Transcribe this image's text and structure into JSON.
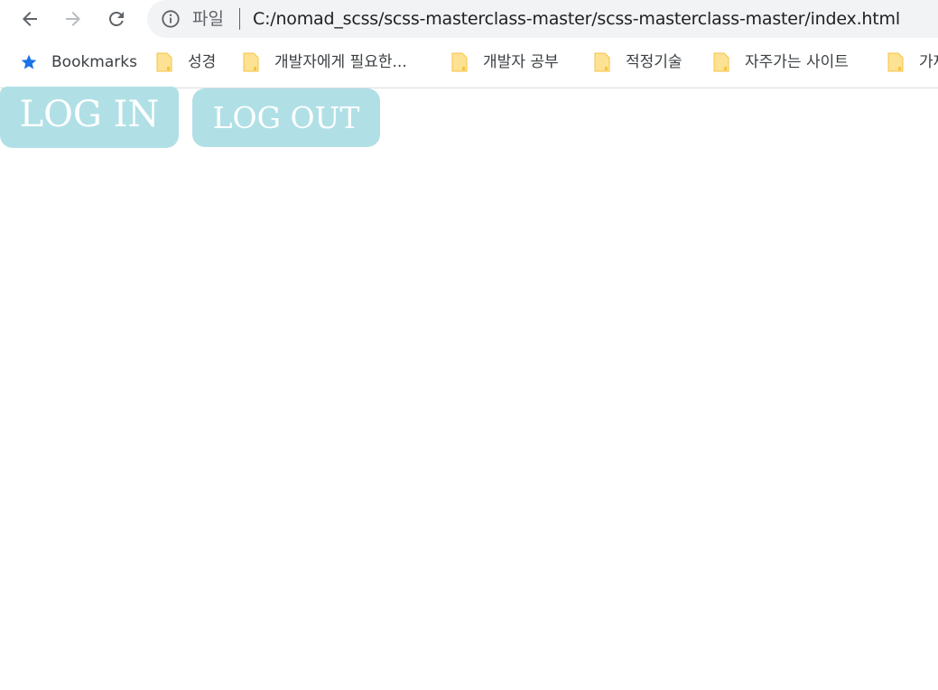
{
  "browser": {
    "omnibox": {
      "scheme_label": "파일",
      "url": "C:/nomad_scss/scss-masterclass-master/scss-masterclass-master/index.html"
    },
    "nav": {
      "back_icon": "arrow-left-icon",
      "forward_icon": "arrow-right-icon",
      "reload_icon": "reload-icon",
      "info_icon": "info-icon"
    },
    "bookmarks": {
      "star_label": "Bookmarks",
      "items": [
        {
          "label": "성경",
          "icon": "folder-icon"
        },
        {
          "label": "개발자에게 필요한...",
          "icon": "folder-icon"
        },
        {
          "label": "개발자 공부",
          "icon": "folder-icon"
        },
        {
          "label": "적정기술",
          "icon": "folder-icon"
        },
        {
          "label": "자주가는 사이트",
          "icon": "folder-icon"
        },
        {
          "label": "가재",
          "icon": "folder-icon"
        }
      ]
    }
  },
  "page": {
    "login_label": "LOG IN",
    "logout_label": "LOG OUT"
  },
  "colors": {
    "button_bg": "#b0e0e6",
    "button_text": "#ffffff",
    "star": "#1a73e8",
    "folder": "#fde293"
  }
}
